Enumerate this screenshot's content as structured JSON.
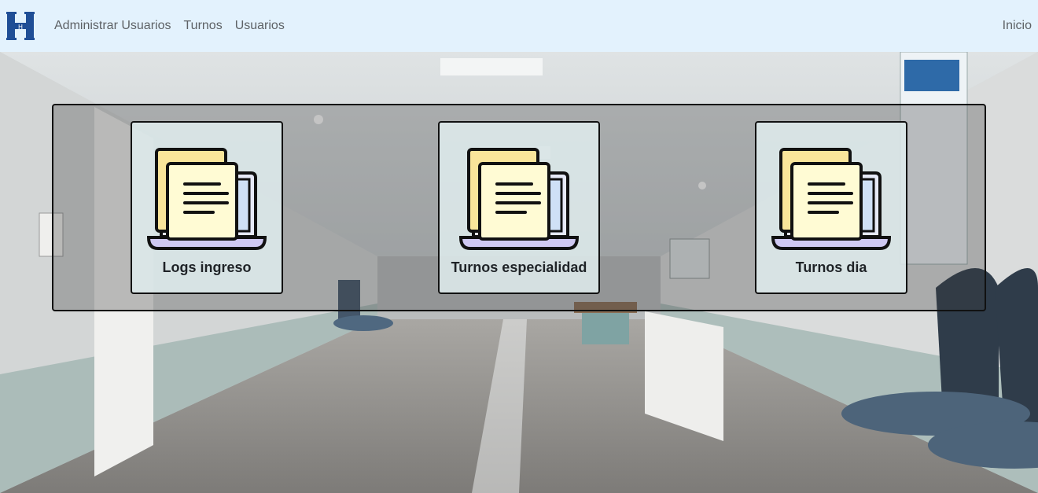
{
  "navbar": {
    "brand_letter": "H",
    "links": [
      "Administrar Usuarios",
      "Turnos",
      "Usuarios"
    ],
    "right_link": "Inicio"
  },
  "cards": [
    {
      "label": "Logs ingreso",
      "icon": "laptop-documents-icon"
    },
    {
      "label": "Turnos especialidad",
      "icon": "laptop-documents-icon"
    },
    {
      "label": "Turnos dia",
      "icon": "laptop-documents-icon"
    }
  ],
  "colors": {
    "navbar_bg": "#e3f2fd",
    "brand": "#1f4e96",
    "nav_text": "#5e6266"
  }
}
